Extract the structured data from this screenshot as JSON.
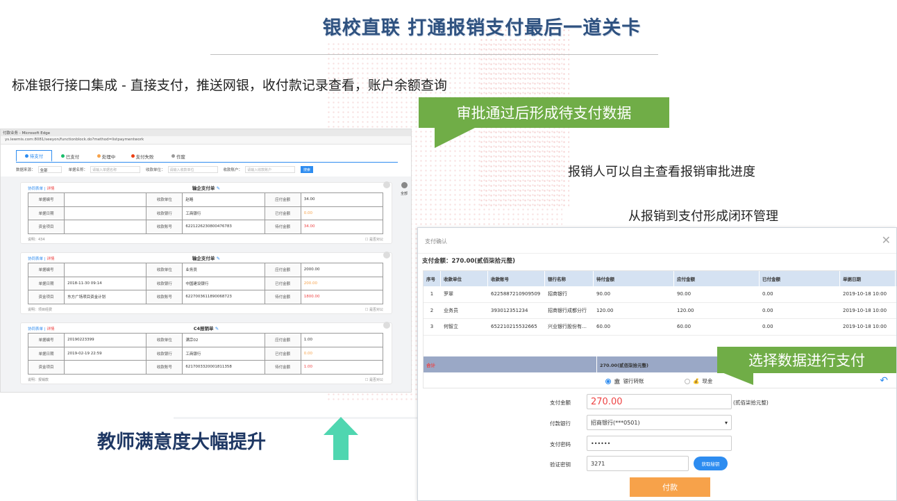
{
  "page": {
    "title": "银校直联  打通报销支付最后一道关卡",
    "subtitle": "标准银行接口集成 - 直接支付，推送网银，收付款记录查看，账户余额查询",
    "callout_approval": "审批通过后形成待支付数据",
    "note_progress": "报销人可以自主查看报销审批进度",
    "note_loop": "从报销到支付形成闭环管理",
    "callout_select": "选择数据进行支付",
    "satisfaction": "教师满意度大幅提升"
  },
  "browser": {
    "window_title": "付款业务 - Microsoft Edge",
    "url": "ys.lewmis.com:8081/seeyon/functionblock.do?method=listpaymentwork",
    "tabs": [
      {
        "label": "待支付",
        "color": "#2d8cf0"
      },
      {
        "label": "已支付",
        "color": "#19be6b"
      },
      {
        "label": "处理中",
        "color": "#f7a24a"
      },
      {
        "label": "支付失败",
        "color": "#ed4014"
      },
      {
        "label": "作废",
        "color": "#999999"
      }
    ],
    "filters": {
      "source_label": "数据来源：",
      "source_value": "全部",
      "bill_no_label": "单据名称：",
      "bill_no_placeholder": "请输入单据名称",
      "payee_label": "收款单位：",
      "payee_placeholder": "请输入收款单位",
      "account_label": "收款账户：",
      "account_placeholder": "请输入收款账户",
      "search_button": "搜索"
    },
    "side": {
      "label": "全部"
    },
    "card_common": {
      "link_form": "协同表单",
      "link_detail": "详情",
      "edit_icon": "✎",
      "label_bill_no": "单据编号",
      "label_bill_date": "单据日期",
      "label_fund_item": "资金项目",
      "label_payee": "收款单位",
      "label_bank": "收款银行",
      "label_account": "收款账号",
      "label_payable": "应付金额",
      "label_paid": "已付金额",
      "label_topay": "待付金额",
      "public_check": "是否对公"
    },
    "cards": [
      {
        "title": "输企支付单",
        "bill_no": "",
        "bill_date": "",
        "fund_item": "",
        "payee": "赵略",
        "bank": "工商银行",
        "account": "6221226230800476783",
        "payable": "34.00",
        "paid": "0.00",
        "topay": "34.00",
        "remark": "说明：434"
      },
      {
        "title": "输企支付单",
        "bill_no": "",
        "bill_date": "2018-11-30 09:14",
        "fund_item": "东方广场项目资金计划",
        "payee": "业务员",
        "bank": "中国建设银行",
        "account": "6227003611890068723",
        "payable": "2000.00",
        "paid": "200.00",
        "topay": "1800.00",
        "remark": "说明：项目经费"
      },
      {
        "title": "C4报销单",
        "bill_no": "20190223399",
        "bill_date": "2019-02-19 22:59",
        "fund_item": "",
        "payee": "满宗02",
        "bank": "工商银行",
        "account": "6217003320001811358",
        "payable": "1.00",
        "paid": "0.00",
        "topay": "1.00",
        "remark": "说明：报销款"
      }
    ]
  },
  "dialog": {
    "title": "支付确认",
    "total_label": "支付金额：270.00(贰佰柒拾元整)",
    "columns": [
      "序号",
      "收款单位",
      "收款账号",
      "银行名称",
      "待付金额",
      "应付金额",
      "已付金额",
      "单据日期"
    ],
    "rows": [
      [
        "1",
        "罗翠",
        "6225887210909509",
        "招商银行",
        "90.00",
        "90.00",
        "0.00",
        "2019-10-18 10:00"
      ],
      [
        "2",
        "业务员",
        "393012351234",
        "招商银行成都分行",
        "120.00",
        "120.00",
        "0.00",
        "2019-10-18 10:00"
      ],
      [
        "3",
        "何智立",
        "652210215532665",
        "兴业银行股份有…",
        "60.00",
        "60.00",
        "0.00",
        "2019-10-18 10:00"
      ]
    ],
    "total_row": {
      "label": "合计",
      "amount": "270.00(贰佰柒拾元整)"
    },
    "pay_bank_option": "银行转账",
    "pay_cash_option": "现金",
    "form": {
      "amount_label": "支付金额",
      "amount_value": "270.00",
      "amount_words": "(贰佰柒拾元整)",
      "bank_label": "付款银行",
      "bank_value": "招商银行(***0501)",
      "password_label": "支付密码",
      "password_value": "••••••",
      "code_label": "验证密钥",
      "code_value": "3271",
      "get_code_button": "获取秘钥",
      "pay_button": "付款"
    }
  }
}
